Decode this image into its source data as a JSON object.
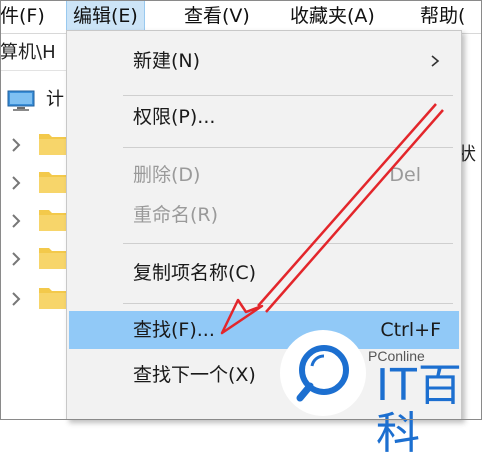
{
  "menubar": {
    "items": [
      {
        "label": "件(F)"
      },
      {
        "label": "编辑(E)"
      },
      {
        "label": "查看(V)"
      },
      {
        "label": "收藏夹(A)"
      },
      {
        "label": "帮助("
      }
    ]
  },
  "address": {
    "text": "算机\\H"
  },
  "tree": {
    "pc_label": "计"
  },
  "right_partial": "状",
  "edit_menu": {
    "items": [
      {
        "label": "新建(N)",
        "shortcut": "",
        "submenu": true,
        "disabled": false
      },
      {
        "label": "权限(P)...",
        "shortcut": "",
        "disabled": false
      },
      {
        "label": "删除(D)",
        "shortcut": "Del",
        "disabled": true
      },
      {
        "label": "重命名(R)",
        "shortcut": "",
        "disabled": true
      },
      {
        "label": "复制项名称(C)",
        "shortcut": "",
        "disabled": false
      },
      {
        "label": "查找(F)...",
        "shortcut": "Ctrl+F",
        "disabled": false,
        "highlighted": true
      },
      {
        "label": "查找下一个(X)",
        "shortcut": "",
        "disabled": false
      }
    ]
  },
  "watermark": {
    "small": "PConline",
    "brand": "IT百科"
  },
  "colors": {
    "highlight": "#91c9f7",
    "menubar_active": "#cce4f7",
    "annotation": "#e3262b",
    "brand": "#1c6fd0"
  }
}
